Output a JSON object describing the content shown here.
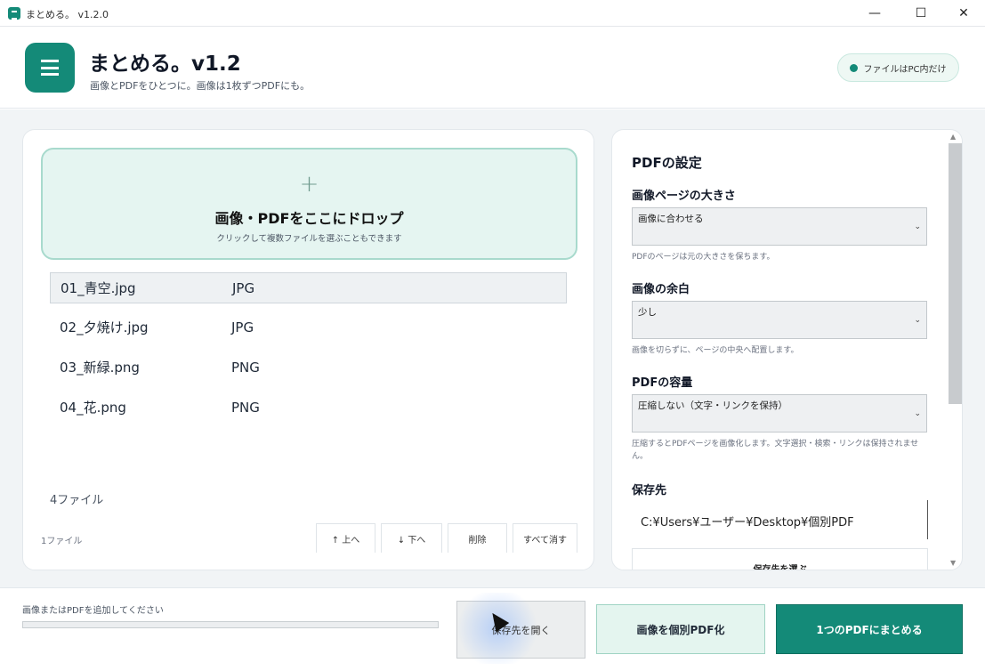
{
  "window": {
    "title": "まとめる。 v1.2.0",
    "controls": [
      "—",
      "☐",
      "✕"
    ]
  },
  "header": {
    "app_title": "まとめる。v1.2",
    "subtitle": "画像とPDFをひとつに。画像は1枚ずつPDFにも。",
    "badge": "ファイルはPC内だけ",
    "logo_icon": "document-list-icon"
  },
  "dropzone": {
    "plus": "+",
    "title": "画像・PDFをここにドロップ",
    "hint": "クリックして複数ファイルを選ぶこともできます"
  },
  "files": [
    {
      "name": "01_青空.jpg",
      "type": "JPG",
      "selected": true
    },
    {
      "name": "02_夕焼け.jpg",
      "type": "JPG",
      "selected": false
    },
    {
      "name": "03_新緑.png",
      "type": "PNG",
      "selected": false
    },
    {
      "name": "04_花.png",
      "type": "PNG",
      "selected": false
    }
  ],
  "file_count": "4ファイル",
  "list_status": "1ファイル",
  "list_buttons": {
    "up": "↑ 上へ",
    "down": "↓ 下へ",
    "delete": "削除",
    "clear_all": "すべて消す"
  },
  "settings": {
    "title": "PDFの設定",
    "page_size": {
      "label": "画像ページの大きさ",
      "value": "画像に合わせる",
      "hint": "PDFのページは元の大きさを保ちます。"
    },
    "margin": {
      "label": "画像の余白",
      "value": "少し",
      "hint": "画像を切らずに、ページの中央へ配置します。"
    },
    "size": {
      "label": "PDFの容量",
      "value": "圧縮しない（文字・リンクを保持）",
      "hint": "圧縮するとPDFページを画像化します。文字選択・検索・リンクは保持されません。"
    },
    "save_to": {
      "label": "保存先",
      "value": "C:¥Users¥ユーザー¥Desktop¥個別PDF",
      "choose_button": "保存先を選ぶ"
    }
  },
  "bottom": {
    "status": "画像またはPDFを追加してください",
    "progress": 0,
    "open_button": "保存先を開く",
    "individual_button": "画像を個別PDF化",
    "merge_button": "1つのPDFにまとめる"
  },
  "colors": {
    "accent": "#148a78",
    "dropzone_bg": "#e5f5f1",
    "secondary_bg": "#e4f5ef"
  }
}
